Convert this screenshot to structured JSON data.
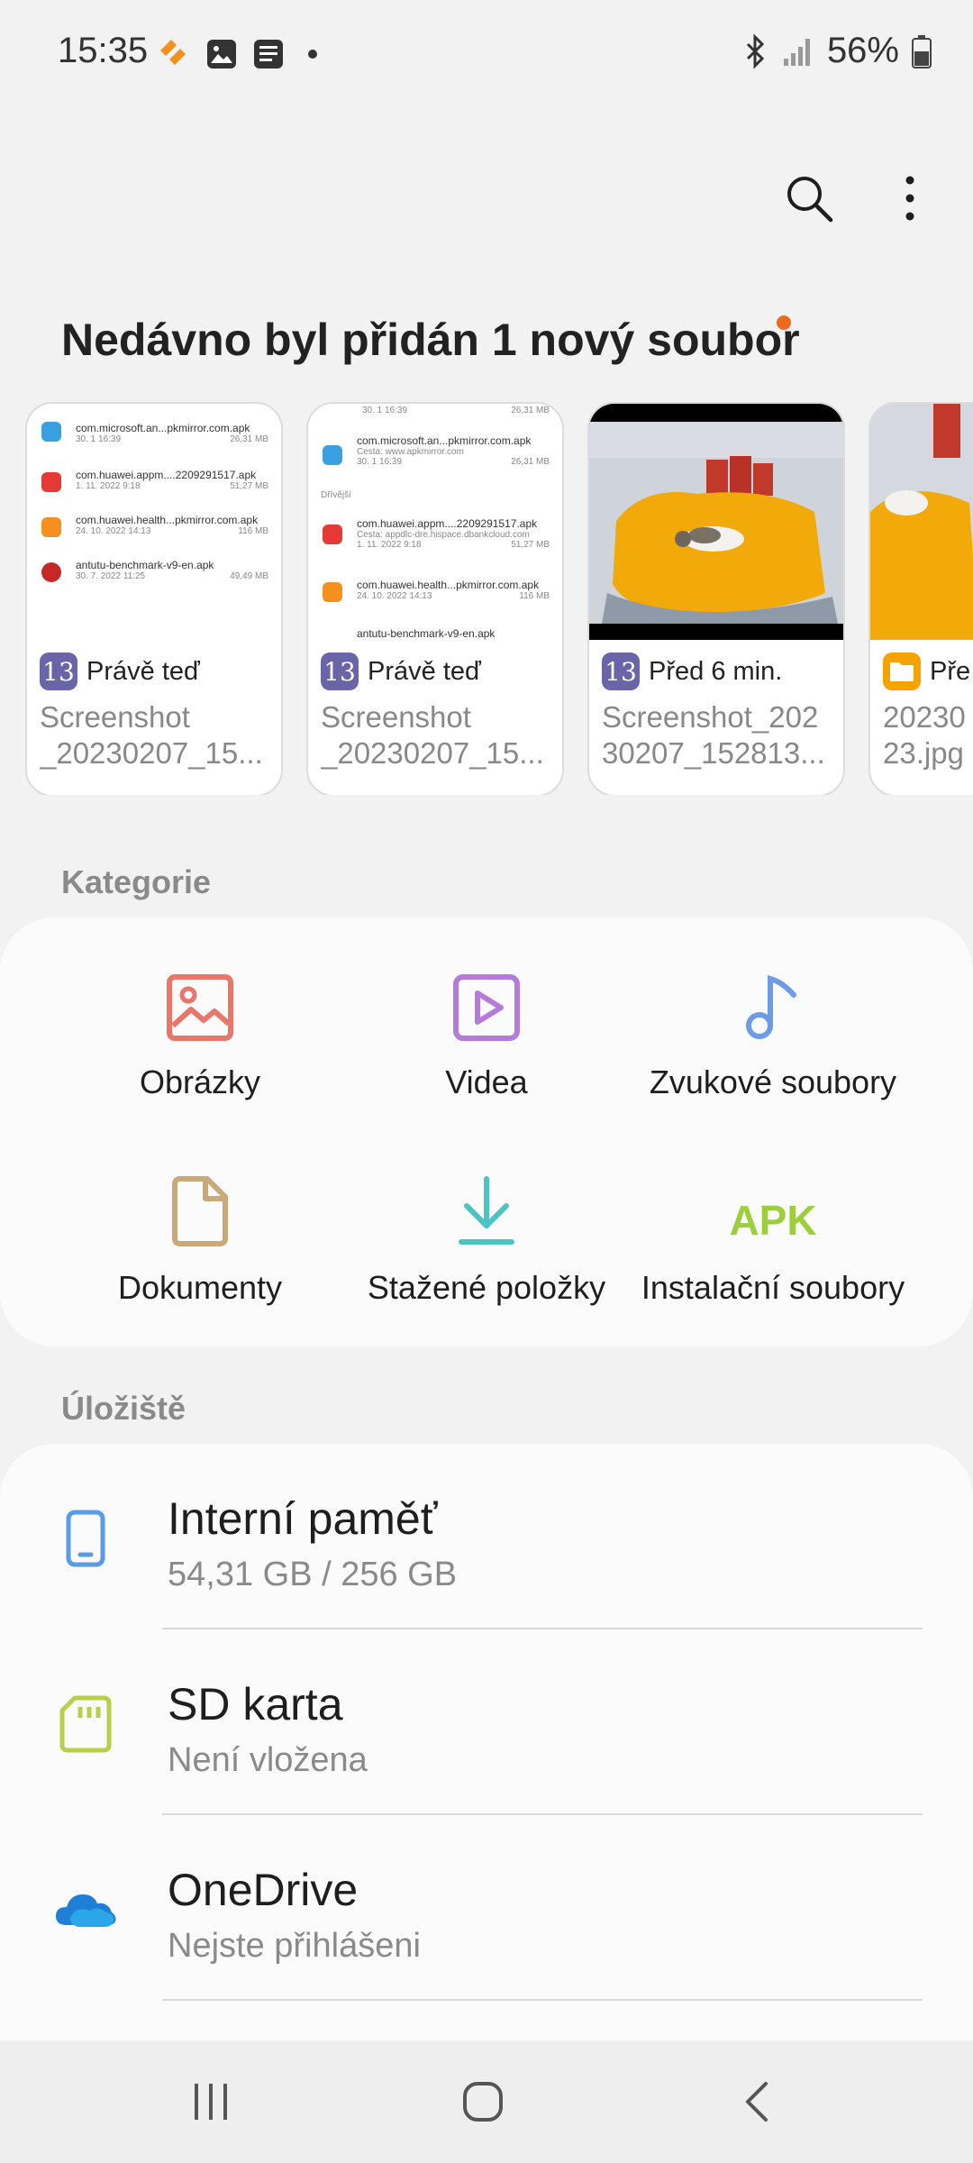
{
  "status_bar": {
    "time": "15:35",
    "battery": "56%"
  },
  "recent": {
    "title": "Nedávno byl přidán 1 nový soubor",
    "cards": [
      {
        "time": "Právě teď",
        "name_line1": "Screenshot",
        "name_line2": "_20230207_15...",
        "badge": "13",
        "rows": [
          {
            "title": "com.microsoft.an...pkmirror.com.apk",
            "date": "30. 1 16:39",
            "size": "26,31 MB"
          },
          {
            "title": "com.huawei.appm....2209291517.apk",
            "date": "1. 11. 2022 9:18",
            "size": "51,27 MB"
          },
          {
            "title": "com.huawei.health...pkmirror.com.apk",
            "date": "24. 10. 2022 14:13",
            "size": "116 MB"
          },
          {
            "title": "antutu-benchmark-v9-en.apk",
            "date": "30. 7. 2022 11:25",
            "size": "49,49 MB"
          }
        ]
      },
      {
        "time": "Právě teď",
        "name_line1": "Screenshot",
        "name_line2": "_20230207_15...",
        "badge": "13",
        "top_line": "30. 1 16:39",
        "top_size": "26,31 MB",
        "section": "Dřívější",
        "rows": [
          {
            "title": "com.microsoft.an...pkmirror.com.apk",
            "sub": "Cesta: www.apkmirror.com",
            "date": "30. 1 16:39",
            "size": "26,31 MB"
          },
          {
            "title": "com.huawei.appm....2209291517.apk",
            "sub": "Cesta: appdlc-dre.hispace.dbankcloud.com",
            "date": "1. 11. 2022 9:18",
            "size": "51,27 MB"
          },
          {
            "title": "com.huawei.health...pkmirror.com.apk",
            "date": "24. 10. 2022 14:13",
            "size": "116 MB"
          },
          {
            "title": "antutu-benchmark-v9-en.apk",
            "date": "",
            "size": ""
          }
        ]
      },
      {
        "time": "Před 6 min.",
        "name_line1": "Screenshot_202",
        "name_line2": "30207_152813...",
        "badge": "13"
      },
      {
        "time": "Pře",
        "name_line1": "20230",
        "name_line2": "23.jpg"
      }
    ]
  },
  "categories": {
    "title": "Kategorie",
    "items": [
      {
        "label": "Obrázky",
        "icon": "image-icon",
        "color": "#e8766a"
      },
      {
        "label": "Videa",
        "icon": "video-icon",
        "color": "#b57bd8"
      },
      {
        "label": "Zvukové soubory",
        "icon": "music-note-icon",
        "color": "#6c9be8"
      },
      {
        "label": "Dokumenty",
        "icon": "document-icon",
        "color": "#c9a87a"
      },
      {
        "label": "Stažené položky",
        "icon": "download-icon",
        "color": "#4cc3c3"
      },
      {
        "label": "Instalační soubory",
        "icon": "apk-icon",
        "color": "#9ccf3b",
        "icon_text": "APK"
      }
    ]
  },
  "storage": {
    "title": "Úložiště",
    "items": [
      {
        "name": "Interní paměť",
        "sub": "54,31 GB / 256 GB",
        "icon": "phone-icon",
        "color": "#5a9be6"
      },
      {
        "name": "SD karta",
        "sub": "Není vložena",
        "icon": "sd-card-icon",
        "color": "#b8cf4a"
      },
      {
        "name": "OneDrive",
        "sub": "Nejste přihlášeni",
        "icon": "onedrive-icon",
        "color": "#1f7fd6"
      }
    ]
  }
}
